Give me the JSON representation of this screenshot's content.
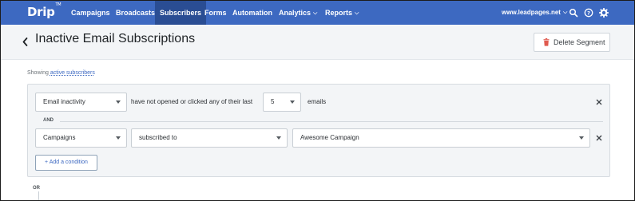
{
  "nav": {
    "logo": "Drip",
    "logo_tm": "TM",
    "items": [
      {
        "label": "Campaigns"
      },
      {
        "label": "Broadcasts"
      },
      {
        "label": "Subscribers"
      },
      {
        "label": "Forms"
      },
      {
        "label": "Automation"
      },
      {
        "label": "Analytics"
      },
      {
        "label": "Reports"
      }
    ],
    "account": "www.leadpages.net"
  },
  "header": {
    "title": "Inactive Email Subscriptions",
    "delete_label": "Delete Segment"
  },
  "showing": {
    "prefix": "Showing",
    "link": "active subscribers"
  },
  "rule1": {
    "type": "Email inactivity",
    "text": "have not opened or clicked any of their last",
    "count": "5",
    "suffix": "emails"
  },
  "and_label": "AND",
  "rule2": {
    "type": "Campaigns",
    "relation": "subscribed to",
    "value": "Awesome Campaign"
  },
  "add_condition": "+ Add a condition",
  "or_label": "OR",
  "colors": {
    "nav_bg": "#3d69c1",
    "nav_active": "#2a4d93",
    "delete_icon": "#e05a4f"
  }
}
